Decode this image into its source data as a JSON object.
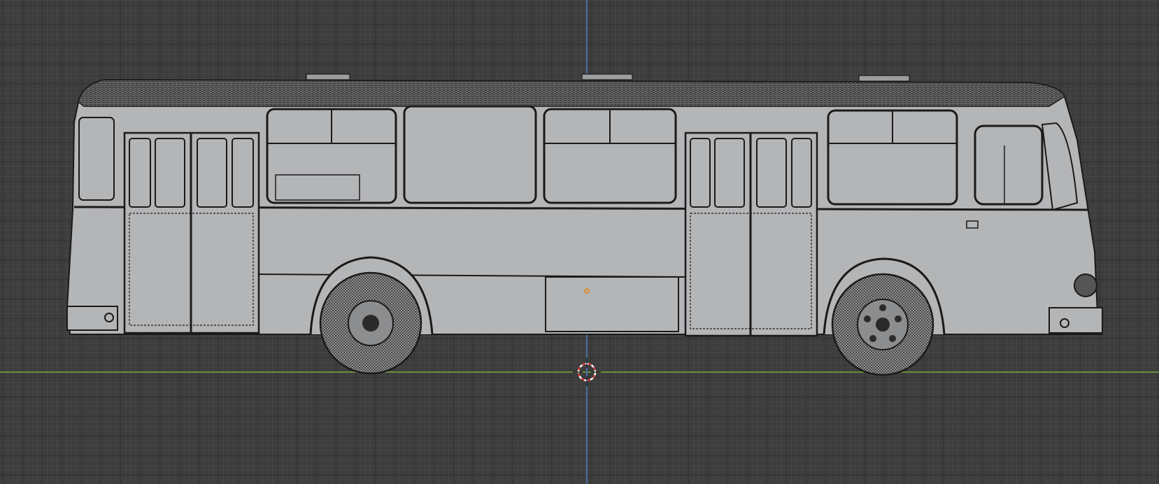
{
  "viewport": {
    "view": "front-orthographic",
    "shading": "wireframe-solid",
    "grid": true,
    "colors": {
      "background": "#3d3d3d",
      "x_axis": "#7da33b",
      "z_axis": "#4a7bc2",
      "mesh_fill": "#b4b5b7",
      "wire": "#1c1c1c",
      "origin": "#e08a1c",
      "cursor_red": "#d93a3a"
    }
  },
  "object": {
    "name_icon": "bus-mesh",
    "origin_icon": "object-origin-dot"
  },
  "cursor": {
    "icon": "3d-cursor-icon"
  }
}
